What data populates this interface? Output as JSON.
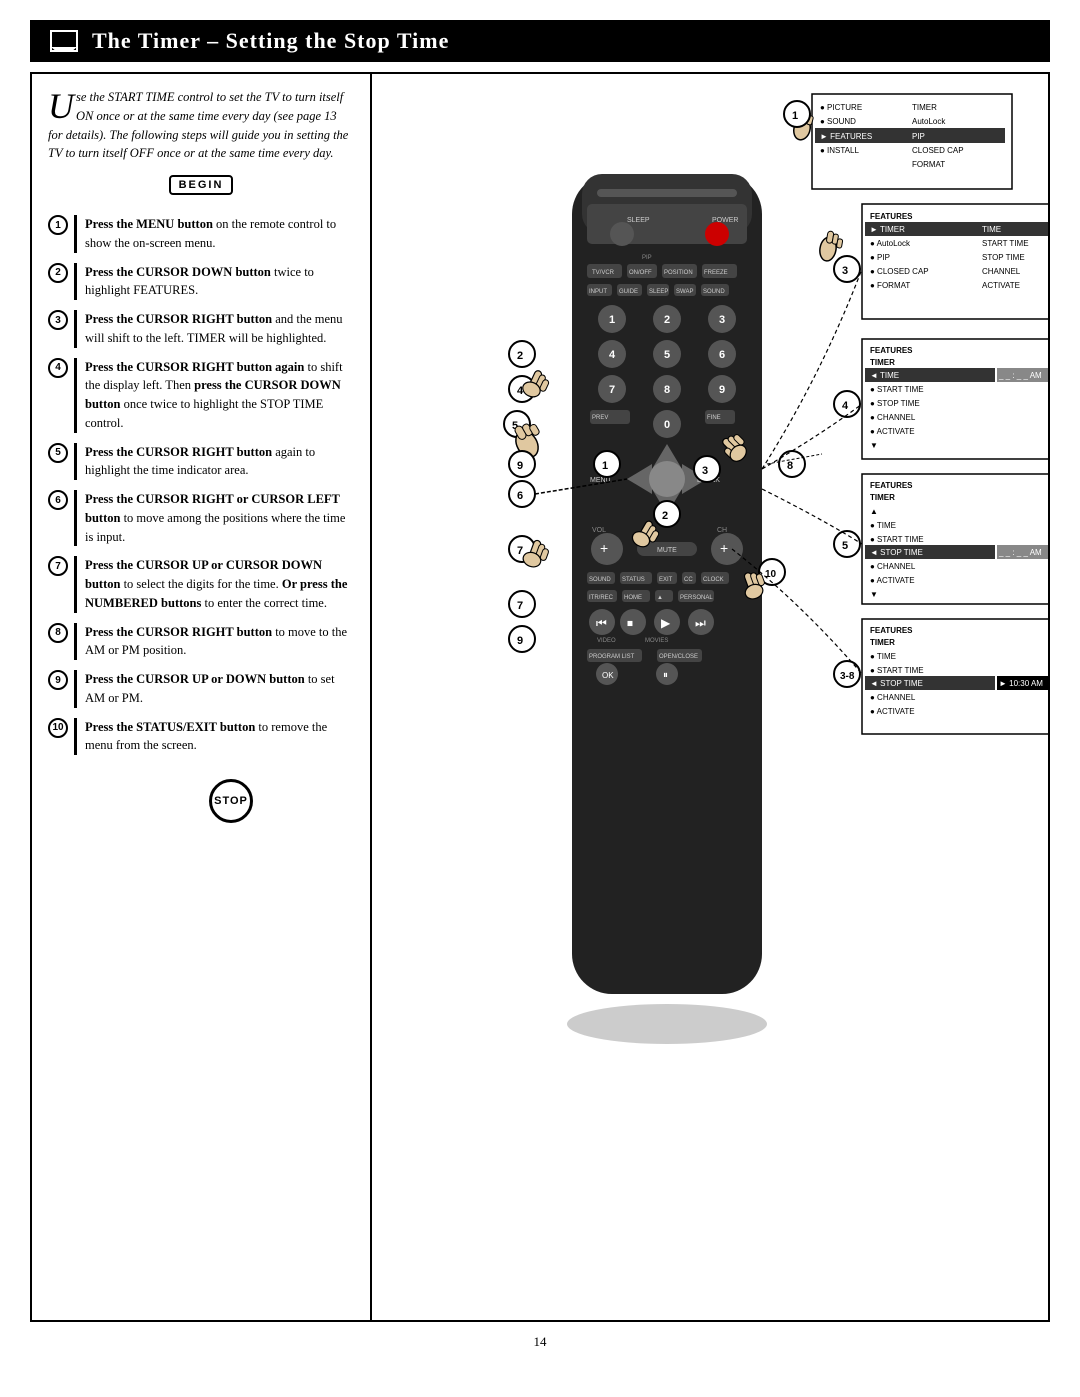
{
  "page": {
    "title": "The Timer – Setting the Stop Time",
    "page_number": "14"
  },
  "intro": {
    "drop_cap": "U",
    "text": "se the START TIME control to set the TV to turn itself ON once or at the same time every day (see page 13 for details). The following steps will guide you in setting the TV to turn itself OFF once or at the same time every day."
  },
  "begin_label": "BEGIN",
  "stop_label": "STOP",
  "steps": [
    {
      "num": "1",
      "text": "Press the MENU button on the remote control to show the on-screen menu."
    },
    {
      "num": "2",
      "text": "Press the CURSOR DOWN button twice to highlight FEATURES."
    },
    {
      "num": "3",
      "text": "Press the CURSOR RIGHT button and the menu will shift to the left. TIMER will be highlighted."
    },
    {
      "num": "4",
      "text": "Press the CURSOR RIGHT button again to shift the display left. Then press the CURSOR DOWN button once twice to highlight the STOP TIME control."
    },
    {
      "num": "5",
      "text": "Press the CURSOR RIGHT button again to highlight the time indicator area."
    },
    {
      "num": "6",
      "text": "Press the CURSOR RIGHT or CURSOR LEFT button to move among the positions where the time is input."
    },
    {
      "num": "7",
      "text": "Press the CURSOR UP or CURSOR DOWN button to select the digits for the time. Or press the NUMBERED buttons to enter the correct time."
    },
    {
      "num": "8",
      "text": "Press the CURSOR RIGHT button to move to the AM or PM position."
    },
    {
      "num": "9",
      "text": "Press the CURSOR UP or DOWN button to set AM or PM."
    },
    {
      "num": "10",
      "text": "Press the STATUS/EXIT button to remove the menu from the screen."
    }
  ],
  "menu_screens": [
    {
      "id": "menu1",
      "title": "",
      "rows": [
        {
          "bullet": "●",
          "left": "PICTURE",
          "right": "TIMER",
          "highlight": false
        },
        {
          "bullet": "●",
          "left": "SOUND",
          "right": "AutoLock",
          "highlight": false
        },
        {
          "bullet": "►",
          "left": "FEATURES",
          "right": "PIP",
          "highlight": true
        },
        {
          "bullet": "●",
          "left": "INSTALL",
          "right": "CLOSED CAP",
          "highlight": false
        },
        {
          "bullet": "",
          "left": "",
          "right": "FORMAT",
          "highlight": false
        }
      ]
    },
    {
      "id": "menu2",
      "title": "FEATURES",
      "rows": [
        {
          "bullet": "►",
          "left": "TIMER",
          "right": "TIME",
          "highlight": true
        },
        {
          "bullet": "●",
          "left": "AutoLock",
          "right": "START TIME",
          "highlight": false
        },
        {
          "bullet": "●",
          "left": "PIP",
          "right": "STOP TIME",
          "highlight": false
        },
        {
          "bullet": "●",
          "left": "CLOSED CAP",
          "right": "CHANNEL",
          "highlight": false
        },
        {
          "bullet": "●",
          "left": "FORMAT",
          "right": "ACTIVATE",
          "highlight": false
        }
      ]
    },
    {
      "id": "menu3",
      "title": "FEATURES",
      "subtitle": "TIMER",
      "rows": [
        {
          "bullet": "◄",
          "left": "TIME",
          "right": "_ _ : _ _ AM",
          "highlight": true
        },
        {
          "bullet": "●",
          "left": "START TIME",
          "right": "",
          "highlight": false
        },
        {
          "bullet": "●",
          "left": "STOP TIME",
          "right": "",
          "highlight": false
        },
        {
          "bullet": "●",
          "left": "CHANNEL",
          "right": "",
          "highlight": false
        },
        {
          "bullet": "●",
          "left": "ACTIVATE",
          "right": "",
          "highlight": false
        },
        {
          "bullet": "▼",
          "left": "",
          "right": "",
          "highlight": false
        }
      ]
    },
    {
      "id": "menu4",
      "title": "FEATURES",
      "subtitle": "TIMER",
      "rows": [
        {
          "bullet": "●",
          "left": "TIME",
          "right": "",
          "highlight": false
        },
        {
          "bullet": "●",
          "left": "START TIME",
          "right": "",
          "highlight": false
        },
        {
          "bullet": "◄",
          "left": "STOP TIME",
          "right": "_ _ : _ _ AM",
          "highlight": true
        },
        {
          "bullet": "●",
          "left": "CHANNEL",
          "right": "",
          "highlight": false
        },
        {
          "bullet": "●",
          "left": "ACTIVATE",
          "right": "",
          "highlight": false
        },
        {
          "bullet": "▼",
          "left": "",
          "right": "",
          "highlight": false
        }
      ]
    },
    {
      "id": "menu5",
      "title": "FEATURES",
      "subtitle": "TIMER",
      "rows": [
        {
          "bullet": "●",
          "left": "TIME",
          "right": "",
          "highlight": false
        },
        {
          "bullet": "●",
          "left": "START TIME",
          "right": "",
          "highlight": false
        },
        {
          "bullet": "◄",
          "left": "STOP TIME",
          "right": "10:30 AM",
          "highlight": true
        },
        {
          "bullet": "●",
          "left": "CHANNEL",
          "right": "",
          "highlight": false
        },
        {
          "bullet": "●",
          "left": "ACTIVATE",
          "right": "",
          "highlight": false
        }
      ]
    }
  ],
  "remote": {
    "label": "Remote Control"
  }
}
